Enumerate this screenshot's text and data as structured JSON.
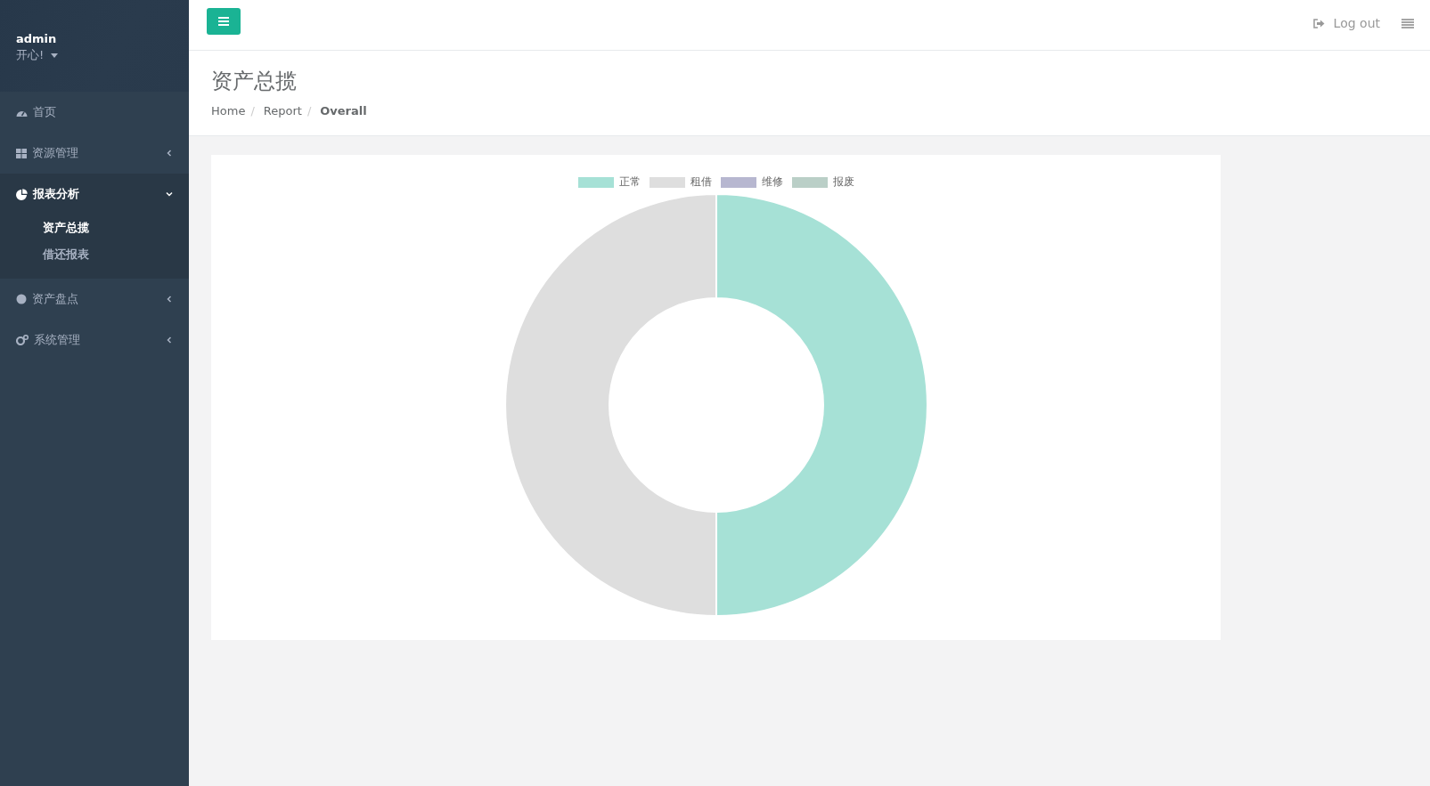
{
  "sidebar": {
    "user": {
      "name": "admin",
      "status": "开心!"
    },
    "items": [
      {
        "label": "首页",
        "expanded": false,
        "has_children": false
      },
      {
        "label": "资源管理",
        "expanded": false,
        "has_children": true
      },
      {
        "label": "报表分析",
        "expanded": true,
        "has_children": true,
        "children": [
          {
            "label": "资产总揽",
            "selected": true
          },
          {
            "label": "借还报表",
            "selected": false
          }
        ]
      },
      {
        "label": "资产盘点",
        "expanded": false,
        "has_children": true
      },
      {
        "label": "系统管理",
        "expanded": false,
        "has_children": true
      }
    ]
  },
  "header": {
    "logout": "Log out"
  },
  "page": {
    "title": "资产总揽",
    "separator": "/",
    "breadcrumb": [
      {
        "label": "Home",
        "selected": false
      },
      {
        "label": "Report",
        "selected": false
      },
      {
        "label": "Overall",
        "selected": true
      }
    ]
  },
  "chart": {
    "legend": [
      {
        "label": "正常",
        "color": "#a6e1d6"
      },
      {
        "label": "租借",
        "color": "#dedede"
      },
      {
        "label": "维修",
        "color": "#b7b7d0"
      },
      {
        "label": "报废",
        "color": "#bacfc7"
      }
    ]
  }
}
